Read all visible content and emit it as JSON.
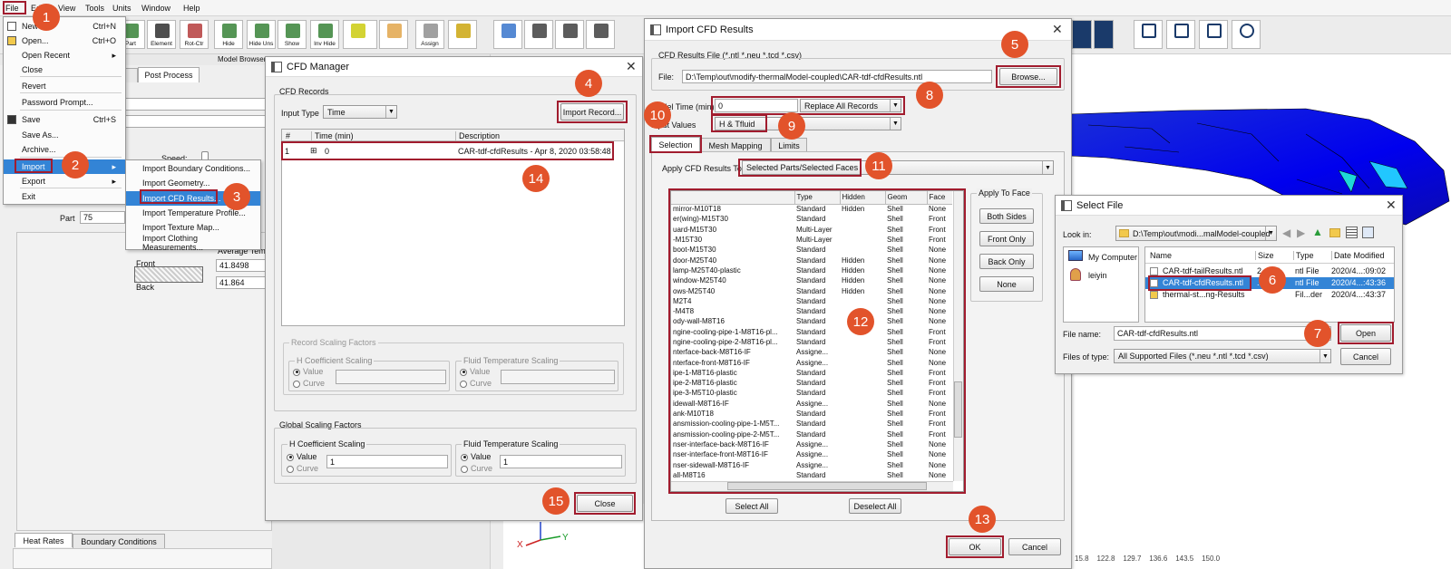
{
  "colors": {
    "accent_blue": "#3384d6",
    "callout": "#e2532b",
    "highlight": "#a11c2e"
  },
  "menubar": {
    "items": [
      "File",
      "Edit",
      "View",
      "Tools",
      "Units",
      "Window",
      "Help"
    ]
  },
  "toolbar": {
    "buttons": [
      {
        "label": "Part",
        "icon": "part-icon"
      },
      {
        "label": "Element",
        "icon": "element-icon"
      },
      {
        "label": "Rot-Ctr",
        "icon": "rotate-center-icon"
      },
      {
        "label": "Hide",
        "icon": "hide-icon"
      },
      {
        "label": "Hide Uns",
        "icon": "hide-unselected-icon"
      },
      {
        "label": "Show",
        "icon": "show-icon"
      },
      {
        "label": "Inv Hide",
        "icon": "invert-hide-icon"
      },
      {
        "label": "",
        "icon": "color-icon"
      },
      {
        "label": "",
        "icon": "paint-icon"
      },
      {
        "label": "Assign",
        "icon": "assign-icon"
      },
      {
        "label": "",
        "icon": "measure-icon"
      },
      {
        "label": "",
        "icon": "view-cube-icon"
      },
      {
        "label": "",
        "icon": "rotate-icon"
      },
      {
        "label": "",
        "icon": "fit-icon"
      },
      {
        "label": "",
        "icon": "zoom-icon"
      }
    ],
    "right_icons": [
      "list-icon",
      "table-icon",
      "report-icon",
      "target-icon"
    ],
    "model_browser": "Model Browser"
  },
  "file_menu": {
    "items": [
      {
        "label": "New",
        "shortcut": "Ctrl+N"
      },
      {
        "label": "Open...",
        "shortcut": "Ctrl+O"
      },
      {
        "label": "Open Recent",
        "submenu": true
      },
      {
        "label": "Close"
      },
      {
        "label": "Revert"
      },
      {
        "label": "Password Prompt..."
      },
      {
        "label": "Save",
        "shortcut": "Ctrl+S"
      },
      {
        "label": "Save As..."
      },
      {
        "label": "Archive..."
      },
      {
        "label": "Import",
        "submenu": true,
        "selected": true
      },
      {
        "label": "Export",
        "submenu": true
      },
      {
        "label": "Exit"
      }
    ]
  },
  "import_submenu": {
    "items": [
      "Import Boundary Conditions...",
      "Import Geometry...",
      "Import CFD Results...",
      "Import Temperature Profile...",
      "Import Texture Map...",
      "Import Clothing Measurements..."
    ],
    "selected": 2
  },
  "left_panel": {
    "tab_post": "Post Process",
    "tab_other": "s",
    "speed_label": "Speed:",
    "part_label": "Part",
    "part_value": "75",
    "avg_temp_label": "Average Temp",
    "front_label": "Front",
    "back_label": "Back",
    "front_value": "41.8498",
    "back_value": "41.864",
    "bottom_tabs": [
      "Heat Rates",
      "Boundary Conditions"
    ]
  },
  "cfd_manager": {
    "title": "CFD Manager",
    "records_label": "CFD Records",
    "input_type_label": "Input Type",
    "input_type_value": "Time",
    "import_record_button": "Import Record...",
    "columns": [
      "#",
      "Time (min)",
      "Description"
    ],
    "rows": [
      {
        "num": "1",
        "time": "0",
        "desc": "CAR-tdf-cfdResults - Apr 8, 2020 03:58:48"
      }
    ],
    "record_scaling": "Record Scaling Factors",
    "global_scaling": "Global Scaling Factors",
    "h_coeff": "H Coefficient Scaling",
    "fluid_temp": "Fluid Temperature Scaling",
    "value": "Value",
    "curve": "Curve",
    "global_h_value": "1",
    "global_fluid_value": "1",
    "close_button": "Close"
  },
  "import_cfd": {
    "title": "Import CFD Results",
    "file_group": "CFD Results File (*.ntl *.neu *.tcd *.csv)",
    "file_label": "File:",
    "file_value": "D:\\Temp\\out\\modify-thermalModel-coupled\\CAR-tdf-cfdResults.ntl",
    "browse_button": "Browse...",
    "model_time_label": "Model Time (min)",
    "model_time_value": "0",
    "replace_value": "Replace All Records",
    "input_values_label": "Input Values",
    "input_values_value": "H & Tfluid",
    "tabs": [
      "Selection",
      "Mesh Mapping",
      "Limits"
    ],
    "apply_to_label": "Apply CFD Results To",
    "apply_to_value": "Selected Parts/Selected Faces",
    "table_columns": [
      "",
      "Type",
      "Hidden",
      "Geom",
      "Face"
    ],
    "parts": [
      [
        "mirror-M10T18",
        "Standard",
        "Hidden",
        "Shell",
        "None"
      ],
      [
        "er(wing)-M15T30",
        "Standard",
        "",
        "Shell",
        "Front"
      ],
      [
        "uard-M15T30",
        "Multi-Layer",
        "",
        "Shell",
        "Front"
      ],
      [
        "-M15T30",
        "Multi-Layer",
        "",
        "Shell",
        "Front"
      ],
      [
        "boot-M15T30",
        "Standard",
        "",
        "Shell",
        "None"
      ],
      [
        "door-M25T40",
        "Standard",
        "Hidden",
        "Shell",
        "None"
      ],
      [
        "lamp-M25T40-plastic",
        "Standard",
        "Hidden",
        "Shell",
        "None"
      ],
      [
        "window-M25T40",
        "Standard",
        "Hidden",
        "Shell",
        "None"
      ],
      [
        "ows-M25T40",
        "Standard",
        "Hidden",
        "Shell",
        "None"
      ],
      [
        "M2T4",
        "Standard",
        "",
        "Shell",
        "None"
      ],
      [
        "-M4T8",
        "Standard",
        "",
        "Shell",
        "None"
      ],
      [
        "ody-wall-M8T16",
        "Standard",
        "",
        "Shell",
        "None"
      ],
      [
        "ngine-cooling-pipe-1-M8T16-pl...",
        "Standard",
        "",
        "Shell",
        "Front"
      ],
      [
        "ngine-cooling-pipe-2-M8T16-pl...",
        "Standard",
        "",
        "Shell",
        "Front"
      ],
      [
        "nterface-back-M8T16-IF",
        "Assigne...",
        "",
        "Shell",
        "None"
      ],
      [
        "nterface-front-M8T16-IF",
        "Assigne...",
        "",
        "Shell",
        "None"
      ],
      [
        "ipe-1-M8T16-plastic",
        "Standard",
        "",
        "Shell",
        "Front"
      ],
      [
        "ipe-2-M8T16-plastic",
        "Standard",
        "",
        "Shell",
        "Front"
      ],
      [
        "ipe-3-M5T10-plastic",
        "Standard",
        "",
        "Shell",
        "Front"
      ],
      [
        "idewall-M8T16-IF",
        "Assigne...",
        "",
        "Shell",
        "None"
      ],
      [
        "ank-M10T18",
        "Standard",
        "",
        "Shell",
        "Front"
      ],
      [
        "ansmission-cooling-pipe-1-M5T...",
        "Standard",
        "",
        "Shell",
        "Front"
      ],
      [
        "ansmission-cooling-pipe-2-M5T...",
        "Standard",
        "",
        "Shell",
        "Front"
      ],
      [
        "nser-interface-back-M8T16-IF",
        "Assigne...",
        "",
        "Shell",
        "None"
      ],
      [
        "nser-interface-front-M8T16-IF",
        "Assigne...",
        "",
        "Shell",
        "None"
      ],
      [
        "nser-sidewall-M8T16-IF",
        "Assigne...",
        "",
        "Shell",
        "None"
      ],
      [
        "all-M8T16",
        "Standard",
        "",
        "Shell",
        "None"
      ]
    ],
    "apply_to_face": "Apply To Face",
    "face_buttons": [
      "Both Sides",
      "Front Only",
      "Back Only",
      "None"
    ],
    "select_all": "Select All",
    "deselect_all": "Deselect All",
    "ok_button": "OK",
    "cancel_button": "Cancel"
  },
  "select_file": {
    "title": "Select File",
    "look_in_label": "Look in:",
    "look_in_value": "D:\\Temp\\out\\modi...malModel-coupled",
    "places": [
      "My Computer",
      "leiyin"
    ],
    "columns": [
      "Name",
      "Size",
      "Type",
      "Date Modified"
    ],
    "files": [
      {
        "name": "CAR-tdf-tailResults.ntl",
        "size": "2...MB",
        "type": "ntl File",
        "date": "2020/4...:09:02"
      },
      {
        "name": "CAR-tdf-cfdResults.ntl",
        "size": "...B",
        "type": "ntl File",
        "date": "2020/4...:43:36"
      },
      {
        "name": "thermal-st...ng-Results",
        "size": "",
        "type": "Fil...der",
        "date": "2020/4...:43:37"
      }
    ],
    "file_name_label": "File name:",
    "file_name_value": "CAR-tdf-cfdResults.ntl",
    "files_of_type_label": "Files of type:",
    "files_of_type_value": "All Supported Files (*.neu *.ntl *.tcd *.csv)",
    "open_button": "Open",
    "cancel_button": "Cancel"
  },
  "viewport": {
    "axis_y": "Y",
    "axis_x": "X",
    "ruler": "15.8    122.8    129.7    136.6    143.5    150.0"
  },
  "callouts": [
    "1",
    "2",
    "3",
    "4",
    "5",
    "6",
    "7",
    "8",
    "9",
    "10",
    "11",
    "12",
    "13",
    "14",
    "15"
  ]
}
